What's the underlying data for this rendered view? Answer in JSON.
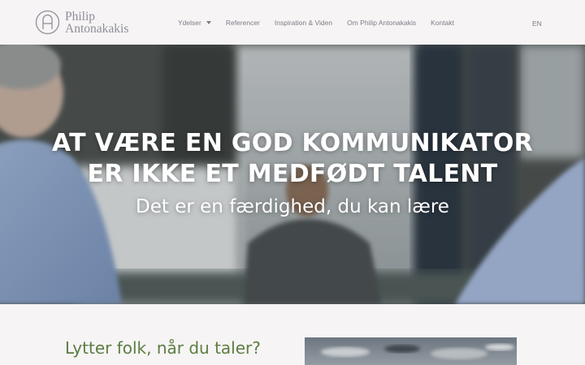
{
  "header": {
    "logo": {
      "line1": "Philip",
      "line2": "Antonakakis",
      "icon": "pa-monogram-icon"
    },
    "nav": [
      {
        "label": "Ydelser",
        "has_dropdown": true
      },
      {
        "label": "Referencer"
      },
      {
        "label": "Inspiration & Viden"
      },
      {
        "label": "Om Philip Antonakakis"
      },
      {
        "label": "Kontakt"
      }
    ],
    "language": "EN"
  },
  "hero": {
    "title_line1": "AT VÆRE EN GOD KOMMUNIKATOR",
    "title_line2": "ER IKKE ET MEDFØDT TALENT",
    "subtitle": "Det er en færdighed, du kan lære"
  },
  "content": {
    "heading": "Lytter folk, når du taler?"
  },
  "colors": {
    "accent_green": "#5c7d43",
    "nav_text": "#7c7c86",
    "logo": "#8e8e9a",
    "background": "#f6f4f4"
  }
}
